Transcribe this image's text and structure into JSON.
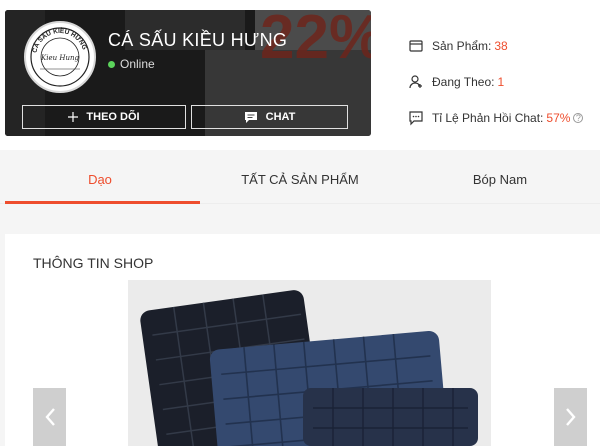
{
  "shop": {
    "name": "CÁ SẤU KIỀU HƯNG",
    "status": "Online",
    "follow_label": "THEO DÕI",
    "chat_label": "CHAT",
    "banner_text": "22%",
    "logo_text": "CÁ SẤU KIỀU HƯNG",
    "logo_script": "Kieu Hung"
  },
  "stats": [
    {
      "label": "Sản Phẩm:",
      "value": "38",
      "icon": "store-icon"
    },
    {
      "label": "Đang Theo:",
      "value": "1",
      "icon": "user-follow-icon"
    },
    {
      "label": "Tỉ Lệ Phản Hồi Chat:",
      "value": "57%",
      "icon": "chat-bubble-icon"
    }
  ],
  "tabs": [
    {
      "label": "Dạo",
      "active": true
    },
    {
      "label": "TẤT CẢ SẢN PHẨM",
      "active": false
    },
    {
      "label": "Bóp Nam",
      "active": false
    }
  ],
  "info": {
    "title": "THÔNG TIN SHOP"
  },
  "colors": {
    "accent": "#ee4d2d",
    "online": "#5bd35b"
  }
}
